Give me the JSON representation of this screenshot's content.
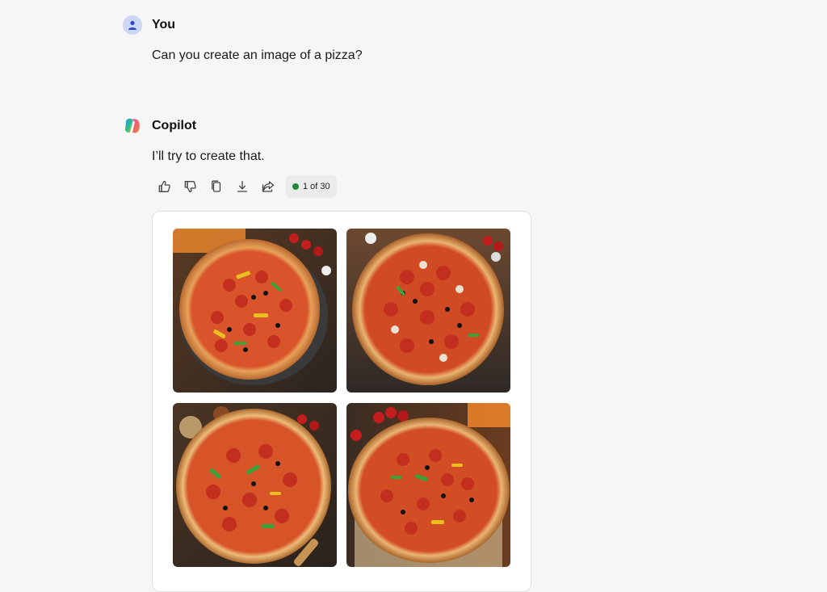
{
  "user_message": {
    "sender": "You",
    "text": "Can you create an image of a pizza?",
    "avatar_icon": "user-icon",
    "avatar_color": "#cdd6f4"
  },
  "copilot_message": {
    "sender": "Copilot",
    "text": "I’ll try to create that.",
    "avatar_icon": "copilot-logo",
    "actions": [
      {
        "name": "thumbs-up-icon"
      },
      {
        "name": "thumbs-down-icon"
      },
      {
        "name": "copy-icon"
      },
      {
        "name": "download-icon"
      },
      {
        "name": "share-icon"
      }
    ],
    "counter": {
      "text": "1 of 30",
      "dot_color": "#1f8a3a"
    }
  },
  "generated_images": [
    {
      "alt": "Pizza with pepperoni, peppers and olives on dark stone"
    },
    {
      "alt": "Pizza with pepperoni, mushrooms and olives"
    },
    {
      "alt": "Pizza with pepperoni, green peppers and olives"
    },
    {
      "alt": "Pizza with pepperoni, olives and peppers near oven"
    }
  ]
}
